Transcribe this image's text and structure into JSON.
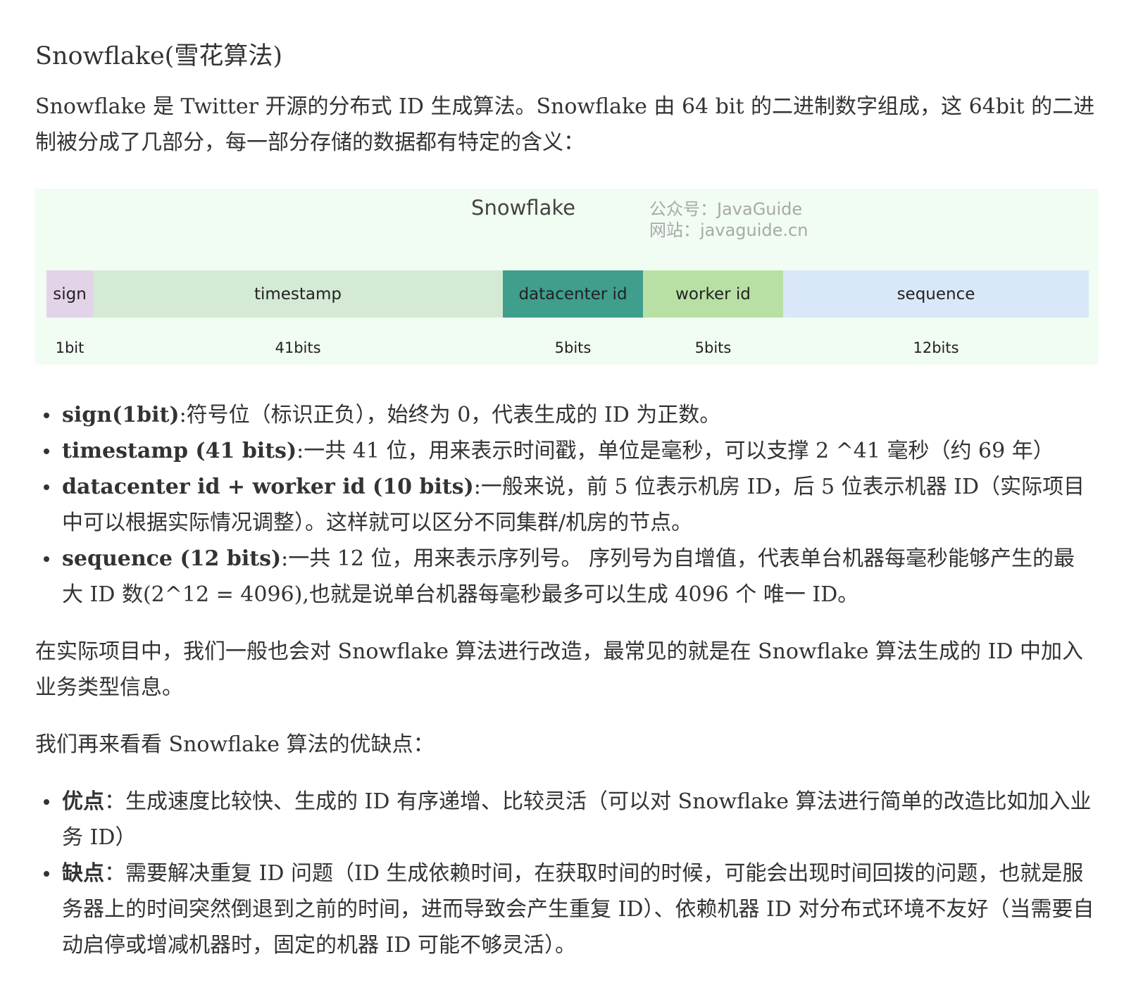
{
  "heading": "Snowflake(雪花算法)",
  "intro": "Snowflake 是 Twitter 开源的分布式 ID 生成算法。Snowflake 由 64 bit 的二进制数字组成，这 64bit 的二进制被分成了几部分，每一部分存储的数据都有特定的含义：",
  "figure": {
    "title": "Snowflake",
    "watermark_line1": "公众号：JavaGuide",
    "watermark_line2": "网站：javaguide.cn",
    "segments": [
      {
        "label": "sign",
        "bits": "1bit",
        "color": "#e3d3e9"
      },
      {
        "label": "timestamp",
        "bits": "41bits",
        "color": "#d4ead4"
      },
      {
        "label": "datacenter id",
        "bits": "5bits",
        "color": "#3f9e8c"
      },
      {
        "label": "worker id",
        "bits": "5bits",
        "color": "#b8e0a4"
      },
      {
        "label": "sequence",
        "bits": "12bits",
        "color": "#d9e8f8"
      }
    ]
  },
  "components": [
    {
      "term": "sign(1bit)",
      "text": ":符号位（标识正负），始终为 0，代表生成的 ID 为正数。"
    },
    {
      "term": "timestamp (41 bits)",
      "text": ":一共 41 位，用来表示时间戳，单位是毫秒，可以支撑 2 ^41 毫秒（约 69 年）"
    },
    {
      "term": "datacenter id + worker id (10 bits)",
      "text": ":一般来说，前 5 位表示机房 ID，后 5 位表示机器 ID（实际项目中可以根据实际情况调整）。这样就可以区分不同集群/机房的节点。"
    },
    {
      "term": "sequence (12 bits)",
      "text": ":一共 12 位，用来表示序列号。 序列号为自增值，代表单台机器每毫秒能够产生的最大 ID 数(2^12 = 4096),也就是说单台机器每毫秒最多可以生成 4096 个 唯一 ID。"
    }
  ],
  "modification": "在实际项目中，我们一般也会对 Snowflake 算法进行改造，最常见的就是在 Snowflake 算法生成的 ID 中加入业务类型信息。",
  "eval_intro": "我们再来看看 Snowflake 算法的优缺点：",
  "pros_cons": [
    {
      "term": "优点",
      "text": "：生成速度比较快、生成的 ID 有序递增、比较灵活（可以对 Snowflake 算法进行简单的改造比如加入业务 ID）"
    },
    {
      "term": "缺点",
      "text": "：需要解决重复 ID 问题（ID 生成依赖时间，在获取时间的时候，可能会出现时间回拨的问题，也就是服务器上的时间突然倒退到之前的时间，进而导致会产生重复 ID）、依赖机器 ID 对分布式环境不友好（当需要自动启停或增减机器时，固定的机器 ID 可能不够灵活）。"
    }
  ]
}
